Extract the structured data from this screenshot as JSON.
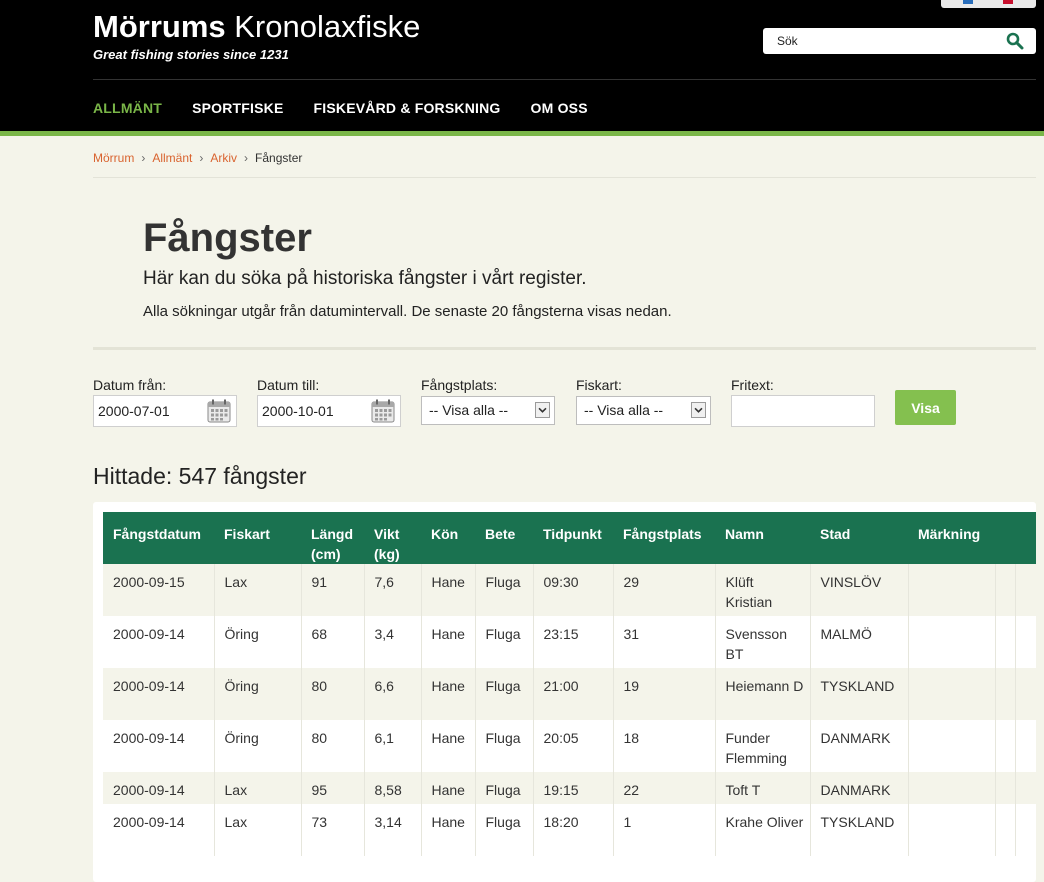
{
  "header": {
    "logo_bold": "Mörrums",
    "logo_rest": " Kronolaxfiske",
    "tagline": "Great fishing stories since 1231",
    "search_placeholder": "Sök",
    "nav": [
      {
        "label": "Allmänt",
        "active": true
      },
      {
        "label": "Sportfiske",
        "active": false
      },
      {
        "label": "Fiskevård & forskning",
        "active": false
      },
      {
        "label": "Om oss",
        "active": false
      }
    ]
  },
  "breadcrumb": {
    "items": [
      "Mörrum",
      "Allmänt",
      "Arkiv"
    ],
    "current": "Fångster"
  },
  "intro": {
    "title": "Fångster",
    "lead": "Här kan du söka på historiska fångster i vårt register.",
    "description": "Alla sökningar utgår från datumintervall. De senaste 20 fångsterna visas nedan."
  },
  "filters": {
    "date_from_label": "Datum från:",
    "date_from_value": "2000-07-01",
    "date_to_label": "Datum till:",
    "date_to_value": "2000-10-01",
    "place_label": "Fångstplats:",
    "place_value": "-- Visa alla --",
    "species_label": "Fiskart:",
    "species_value": "-- Visa alla --",
    "freetext_label": "Fritext:",
    "freetext_value": "",
    "submit_label": "Visa"
  },
  "results": {
    "heading": "Hittade: 547 fångster",
    "columns": [
      "Fångstdatum",
      "Fiskart",
      "Längd (cm)",
      "Vikt (kg)",
      "Kön",
      "Bete",
      "Tidpunkt",
      "Fångstplats",
      "Namn",
      "Stad",
      "Märkning",
      "",
      ""
    ],
    "rows": [
      [
        "2000-09-15",
        "Lax",
        "91",
        "7,6",
        "Hane",
        "Fluga",
        "09:30",
        "29",
        "Klüft Kristian",
        "VINSLÖV",
        "",
        "",
        ""
      ],
      [
        "2000-09-14",
        "Öring",
        "68",
        "3,4",
        "Hane",
        "Fluga",
        "23:15",
        "31",
        "Svensson BT",
        "MALMÖ",
        "",
        "",
        ""
      ],
      [
        "2000-09-14",
        "Öring",
        "80",
        "6,6",
        "Hane",
        "Fluga",
        "21:00",
        "19",
        "Heiemann D",
        "TYSKLAND",
        "",
        "",
        ""
      ],
      [
        "2000-09-14",
        "Öring",
        "80",
        "6,1",
        "Hane",
        "Fluga",
        "20:05",
        "18",
        "Funder Flemming",
        "DANMARK",
        "",
        "",
        ""
      ],
      [
        "2000-09-14",
        "Lax",
        "95",
        "8,58",
        "Hane",
        "Fluga",
        "19:15",
        "22",
        "Toft T",
        "DANMARK",
        "",
        "",
        ""
      ],
      [
        "2000-09-14",
        "Lax",
        "73",
        "3,14",
        "Hane",
        "Fluga",
        "18:20",
        "1",
        "Krahe Oliver",
        "TYSKLAND",
        "",
        "",
        ""
      ]
    ]
  },
  "colors": {
    "header_bg": "#000000",
    "accent_green": "#7ab648",
    "table_header": "#1a7250",
    "link_orange": "#d9632f",
    "page_bg": "#f4f4ea"
  },
  "icons": {
    "search": "search-icon",
    "calendar": "calendar-icon",
    "dropdown": "chevron-down-icon"
  }
}
